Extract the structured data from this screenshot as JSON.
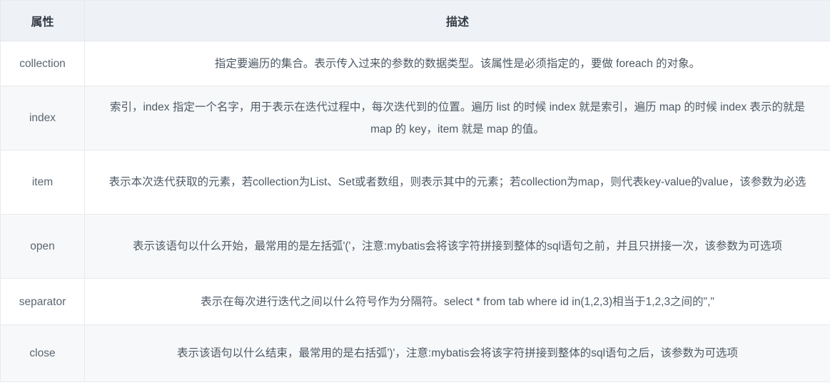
{
  "table": {
    "headers": {
      "attribute": "属性",
      "description": "描述"
    },
    "rows": [
      {
        "attribute": "collection",
        "description": "指定要遍历的集合。表示传入过来的参数的数据类型。该属性是必须指定的，要做 foreach 的对象。"
      },
      {
        "attribute": "index",
        "description": "索引，index 指定一个名字，用于表示在迭代过程中，每次迭代到的位置。遍历 list 的时候 index 就是索引，遍历 map 的时候 index 表示的就是 map 的 key，item 就是 map 的值。"
      },
      {
        "attribute": "item",
        "description": "表示本次迭代获取的元素，若collection为List、Set或者数组，则表示其中的元素；若collection为map，则代表key-value的value，该参数为必选"
      },
      {
        "attribute": "open",
        "description": "表示该语句以什么开始，最常用的是左括弧'('，注意:mybatis会将该字符拼接到整体的sql语句之前，并且只拼接一次，该参数为可选项"
      },
      {
        "attribute": "separator",
        "description": "表示在每次进行迭代之间以什么符号作为分隔符。select * from tab where id in(1,2,3)相当于1,2,3之间的\",\""
      },
      {
        "attribute": "close",
        "description": "表示该语句以什么结束，最常用的是右括弧')'，注意:mybatis会将该字符拼接到整体的sql语句之后，该参数为可选项"
      }
    ]
  },
  "colors": {
    "header_background": "#eef2f6",
    "stripe_background": "#f7f8f9",
    "row_background": "#ffffff",
    "border": "#e8eaed",
    "text": "#4e5a66",
    "header_text": "#333b45"
  }
}
